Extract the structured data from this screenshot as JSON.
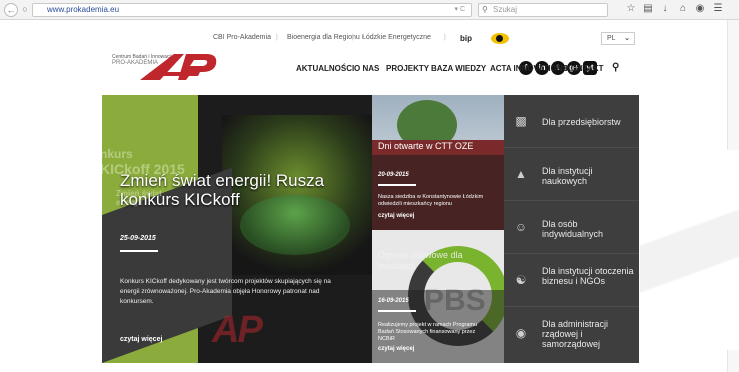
{
  "browser": {
    "url": "www.prokademia.eu",
    "search_placeholder": "Szukaj"
  },
  "topmenu": {
    "items": [
      "CBI Pro-Akademia",
      "Bioenergia dla Regionu",
      "Łódzkie Energetyczne",
      "bip"
    ]
  },
  "social": [
    "f",
    "in",
    "t",
    "g+",
    "yt"
  ],
  "lang": "PL",
  "logo": {
    "line1": "Centrum Badań i Innowacji",
    "line2": "PRO-AKADEMIA",
    "mark": "AP"
  },
  "mainnav": [
    "AKTUALNOŚCI",
    "O NAS",
    "PROJEKTY",
    "BAZA WIEDZY",
    "ACTA INNOVATIONS",
    "KONTAKT"
  ],
  "hero": {
    "ghost_top": "nkurs",
    "ghost_mid": "KICkoff 2015",
    "ghost_small": "Zmień świat\nenergii",
    "title": "Zmień świat energii! Rusza konkurs KICkoff",
    "date": "25-09-2015",
    "description": "Konkurs KICkoff dedykowany jest twórcom projektów skupiających się na energii zrównoważonej. Pro-Akademia objęła Honorowy patronat nad konkursem.",
    "more": "czytaj więcej",
    "watermark": "AP"
  },
  "card1": {
    "title": "Dni otwarte w CTT OZE",
    "date": "20-09-2015",
    "description": "Nasza siedziba w Konstantynowie Łódzkim odwiedzili mieszkańcy regionu",
    "more": "czytaj więcej"
  },
  "card2": {
    "title": "Ogniwa paliwowe dla innowacji",
    "logo_text": "PBS",
    "date": "16-09-2015",
    "description": "Realizujemy projekt w ramach Programu Badań Stosowanych finansowany przez NCBiR",
    "more": "czytaj więcej"
  },
  "categories": [
    {
      "label": "Dla przedsiębiorstw",
      "icon": "chart-bars-icon"
    },
    {
      "label": "Dla instytucji naukowych",
      "icon": "graduation-cap-icon"
    },
    {
      "label": "Dla osób indywidualnych",
      "icon": "person-icon"
    },
    {
      "label": "Dla instytucji otoczenia biznesu i NGOs",
      "icon": "handshake-icon"
    },
    {
      "label": "Dla administracji rządowej i samorządowej",
      "icon": "coins-icon"
    }
  ],
  "colors": {
    "brand_red": "#c0272d",
    "green": "#8bac3c",
    "panel_dark": "#3e3e3e"
  }
}
